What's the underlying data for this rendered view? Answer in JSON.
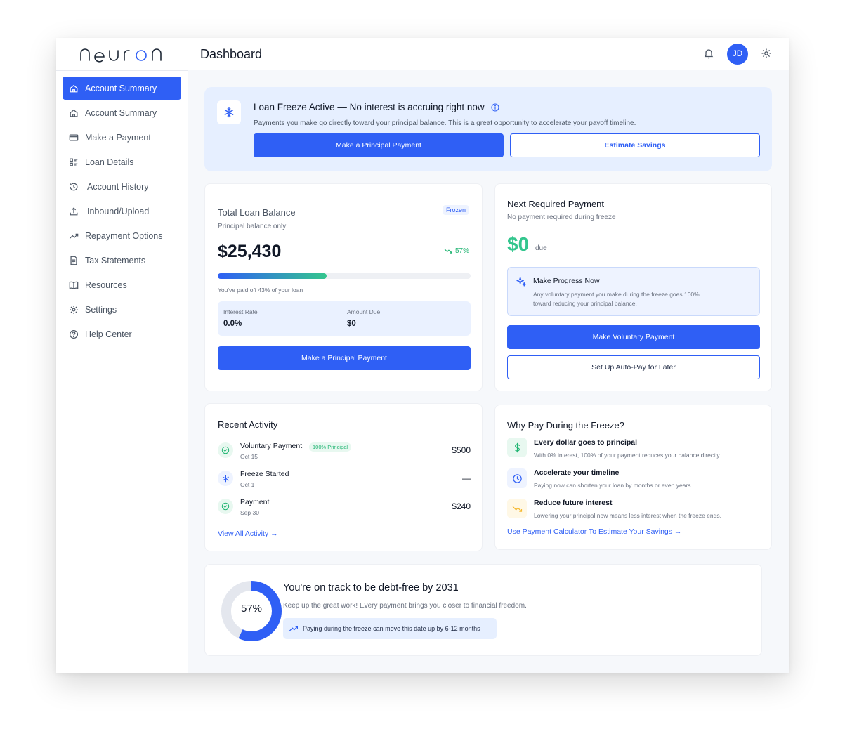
{
  "app": {
    "logo": "neuron"
  },
  "sidebar": {
    "items": [
      {
        "label": "Account Summary",
        "icon": "home-icon",
        "active": true
      },
      {
        "label": "Account Summary",
        "icon": "home-icon"
      },
      {
        "label": "Make a Payment",
        "icon": "credit-card-icon"
      },
      {
        "label": "Loan Details",
        "icon": "list-details-icon"
      },
      {
        "label": "Account History",
        "icon": "history-icon"
      },
      {
        "label": "Inbound/Upload",
        "icon": "upload-icon"
      },
      {
        "label": "Repayment Options",
        "icon": "trending-up-icon"
      },
      {
        "label": "Tax Statements",
        "icon": "document-icon"
      },
      {
        "label": "Resources",
        "icon": "book-icon"
      },
      {
        "label": "Settings",
        "icon": "gear-icon"
      },
      {
        "label": "Help Center",
        "icon": "help-circle-icon"
      }
    ]
  },
  "header": {
    "title": "Dashboard",
    "avatar_initials": "JD"
  },
  "banner": {
    "title": "Loan Freeze Active — No interest is accruing right now",
    "description": "Payments you make go directly toward your principal balance. This is a great opportunity to accelerate your payoff timeline.",
    "primary_button": "Make a Principal Payment",
    "secondary_button": "Estimate Savings"
  },
  "balance": {
    "title": "Total Loan Balance",
    "badge": "Frozen",
    "subtitle": "Principal balance only",
    "amount": "$25,430",
    "change": "57%",
    "progress_percent": 43,
    "progress_caption": "You've paid off 43% of your loan",
    "interest_label": "Interest Rate",
    "interest_value": "0.0%",
    "amount_due_label": "Amount Due",
    "amount_due_value": "$0",
    "button": "Make a Principal Payment"
  },
  "next_payment": {
    "title": "Next Required Payment",
    "subtitle": "No payment required during freeze",
    "amount": "$0",
    "amount_suffix": "due",
    "progress_title": "Make Progress Now",
    "progress_desc_1": "Any voluntary payment you make during the freeze goes 100%",
    "progress_desc_2": "toward reducing your principal balance.",
    "primary_button": "Make Voluntary Payment",
    "secondary_button": "Set Up Auto-Pay for Later"
  },
  "activity": {
    "title": "Recent Activity",
    "items": [
      {
        "name": "Voluntary Payment",
        "tag": "100% Principal",
        "date": "Oct 15",
        "amount": "$500",
        "icon": "check-circle-icon"
      },
      {
        "name": "Freeze Started",
        "tag": "",
        "date": "Oct 1",
        "amount": "—",
        "icon": "snowflake-icon"
      },
      {
        "name": "Payment",
        "tag": "",
        "date": "Sep 30",
        "amount": "$240",
        "icon": "check-circle-icon"
      }
    ],
    "link": "View All Activity →"
  },
  "why": {
    "title": "Why Pay During the Freeze?",
    "items": [
      {
        "title": "Every dollar goes to principal",
        "desc": "With 0% interest, 100% of your payment reduces your balance directly.",
        "icon": "dollar-icon"
      },
      {
        "title": "Accelerate your timeline",
        "desc": "Paying now can shorten your loan by months or even years.",
        "icon": "clock-icon"
      },
      {
        "title": "Reduce future interest",
        "desc": "Lowering your principal now means less interest when the freeze ends.",
        "icon": "trending-down-icon"
      }
    ],
    "link": "Use Payment Calculator To Estimate Your Savings →"
  },
  "track": {
    "percent": 57,
    "percent_label": "57%",
    "title": "You're on track to be debt-free by 2031",
    "desc": "Keep up the great work! Every payment brings you closer to financial freedom.",
    "chip": "Paying during the freeze can move this date up by 6-12 months"
  },
  "colors": {
    "accent": "#2f5ff5",
    "success": "#34c68e",
    "warning": "#f5b82e"
  }
}
